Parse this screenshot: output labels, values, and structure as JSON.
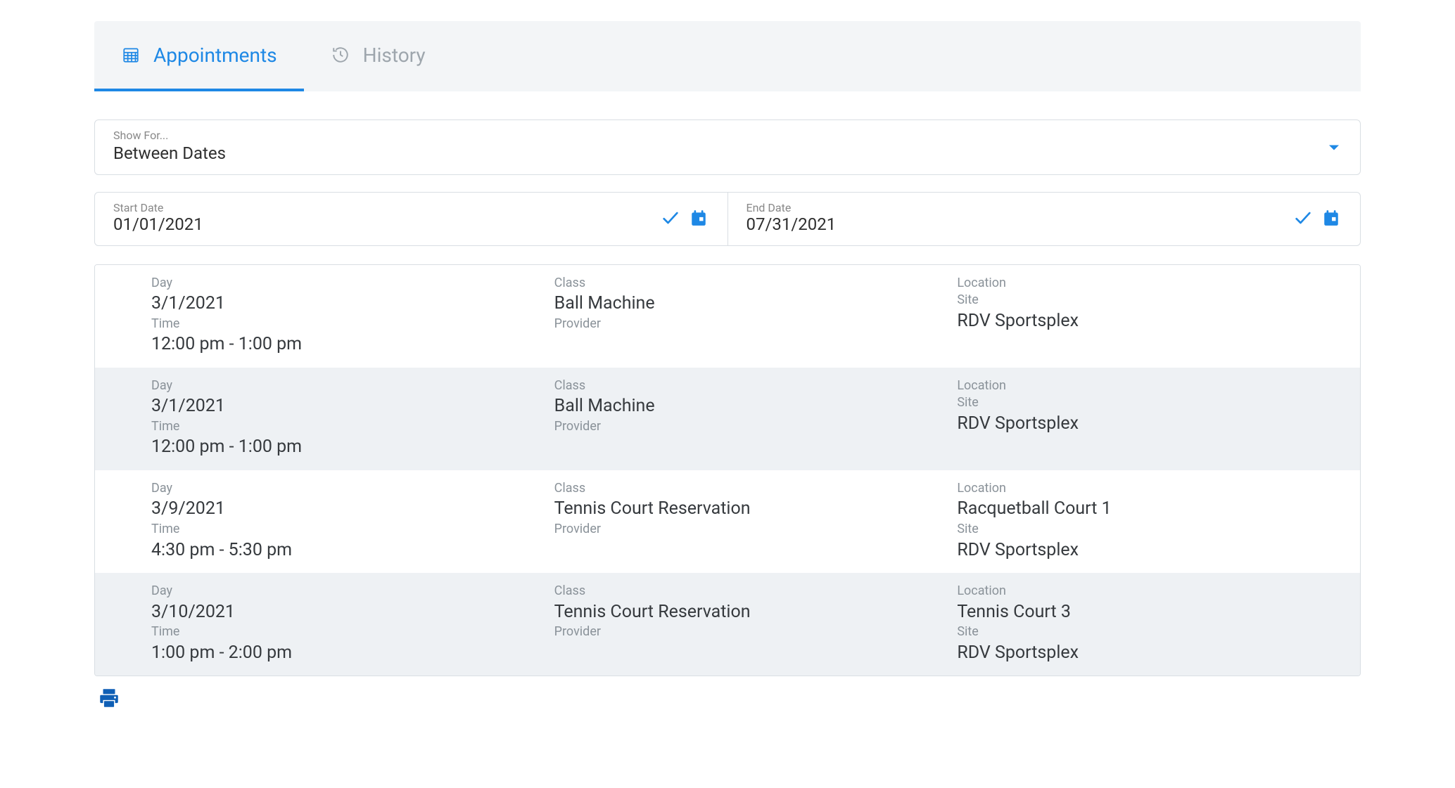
{
  "tabs": {
    "appointments": "Appointments",
    "history": "History"
  },
  "filter": {
    "label": "Show For...",
    "value": "Between Dates"
  },
  "dates": {
    "start": {
      "label": "Start Date",
      "value": "01/01/2021"
    },
    "end": {
      "label": "End Date",
      "value": "07/31/2021"
    }
  },
  "labels": {
    "day": "Day",
    "time": "Time",
    "class": "Class",
    "provider": "Provider",
    "location": "Location",
    "site": "Site"
  },
  "appointments": [
    {
      "day": "3/1/2021",
      "time": "12:00 pm - 1:00 pm",
      "class": "Ball Machine",
      "provider": "",
      "location": "",
      "site": "RDV Sportsplex"
    },
    {
      "day": "3/1/2021",
      "time": "12:00 pm - 1:00 pm",
      "class": "Ball Machine",
      "provider": "",
      "location": "",
      "site": "RDV Sportsplex"
    },
    {
      "day": "3/9/2021",
      "time": "4:30 pm - 5:30 pm",
      "class": "Tennis Court Reservation",
      "provider": "",
      "location": "Racquetball Court 1",
      "site": "RDV Sportsplex"
    },
    {
      "day": "3/10/2021",
      "time": "1:00 pm - 2:00 pm",
      "class": "Tennis Court Reservation",
      "provider": "",
      "location": "Tennis Court 3",
      "site": "RDV Sportsplex"
    }
  ]
}
